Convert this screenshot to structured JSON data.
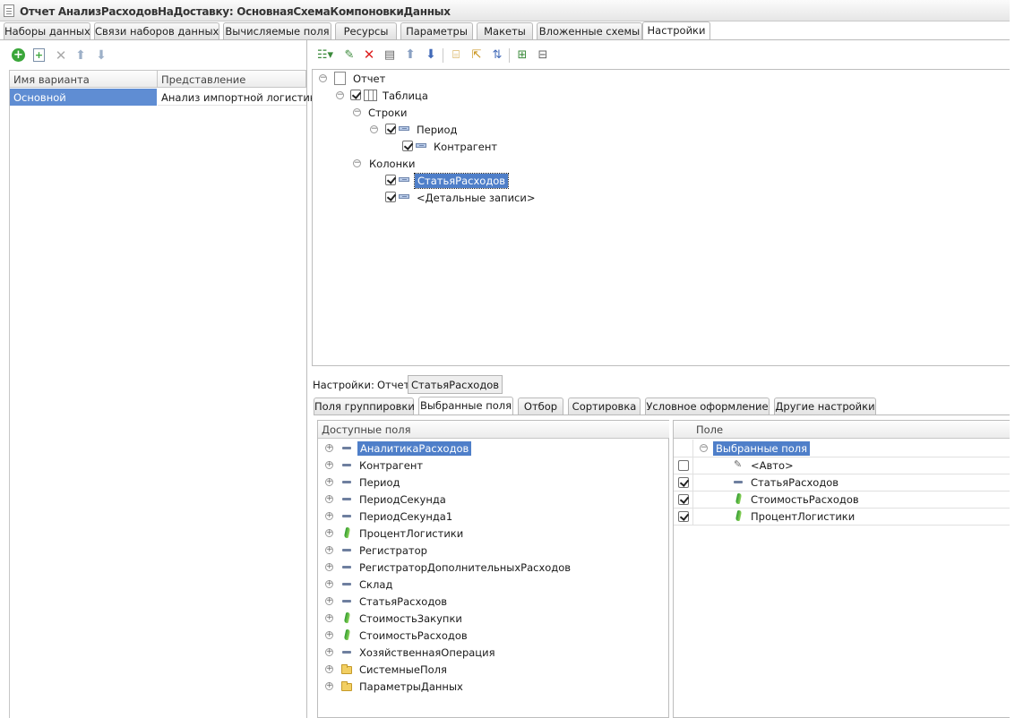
{
  "window": {
    "title": "Отчет АнализРасходовНаДоставку: ОсновнаяСхемаКомпоновкиДанных"
  },
  "top_tabs": [
    {
      "label": "Наборы данных",
      "active": false
    },
    {
      "label": "Связи наборов данных",
      "active": false
    },
    {
      "label": "Вычисляемые поля",
      "active": false
    },
    {
      "label": "Ресурсы",
      "active": false
    },
    {
      "label": "Параметры",
      "active": false
    },
    {
      "label": "Макеты",
      "active": false
    },
    {
      "label": "Вложенные схемы",
      "active": false
    },
    {
      "label": "Настройки",
      "active": true
    }
  ],
  "variants": {
    "toolbar_icons": [
      "add-icon",
      "copy-add-icon",
      "delete-icon",
      "move-up-icon",
      "move-down-icon"
    ],
    "columns": [
      "Имя варианта",
      "Представление"
    ],
    "rows": [
      {
        "name": "Основной",
        "presentation": "Анализ импортной логистики",
        "selected": true
      }
    ]
  },
  "structure": {
    "toolbar_icons": [
      "add-dropdown-icon",
      "edit-icon",
      "delete-icon",
      "properties-icon",
      "move-up-icon",
      "move-down-icon",
      "group-icon",
      "ungroup-icon",
      "swap-icon",
      "expand-icon",
      "collapse-icon"
    ],
    "nodes": [
      {
        "label": "Отчет",
        "kind": "report",
        "toggle": "minus",
        "checkbox": null
      },
      {
        "label": "Таблица",
        "kind": "table",
        "toggle": "minus",
        "checkbox": true
      },
      {
        "label": "Строки",
        "kind": "section",
        "toggle": "minus",
        "checkbox": null
      },
      {
        "label": "Период",
        "kind": "grouping",
        "toggle": "minus",
        "checkbox": true
      },
      {
        "label": "Контрагент",
        "kind": "grouping",
        "toggle": null,
        "checkbox": true
      },
      {
        "label": "Колонки",
        "kind": "section",
        "toggle": "minus",
        "checkbox": null
      },
      {
        "label": "СтатьяРасходов",
        "kind": "grouping",
        "toggle": null,
        "checkbox": true,
        "selected": true
      },
      {
        "label": "<Детальные записи>",
        "kind": "grouping",
        "toggle": null,
        "checkbox": true
      }
    ]
  },
  "settings_bar": {
    "label": "Настройки:",
    "report_button": "Отчет",
    "current_button": "СтатьяРасходов"
  },
  "sub_tabs": [
    {
      "label": "Поля группировки",
      "active": false
    },
    {
      "label": "Выбранные поля",
      "active": true
    },
    {
      "label": "Отбор",
      "active": false
    },
    {
      "label": "Сортировка",
      "active": false
    },
    {
      "label": "Условное оформление",
      "active": false
    },
    {
      "label": "Другие настройки",
      "active": false
    }
  ],
  "available_fields": {
    "header": "Доступные поля",
    "items": [
      {
        "label": "АналитикаРасходов",
        "icon": "dimension-icon",
        "selected": true
      },
      {
        "label": "Контрагент",
        "icon": "dimension-icon"
      },
      {
        "label": "Период",
        "icon": "dimension-icon"
      },
      {
        "label": "ПериодСекунда",
        "icon": "dimension-icon"
      },
      {
        "label": "ПериодСекунда1",
        "icon": "dimension-icon"
      },
      {
        "label": "ПроцентЛогистики",
        "icon": "resource-icon"
      },
      {
        "label": "Регистратор",
        "icon": "dimension-icon"
      },
      {
        "label": "РегистраторДополнительныхРасходов",
        "icon": "dimension-icon"
      },
      {
        "label": "Склад",
        "icon": "dimension-icon"
      },
      {
        "label": "СтатьяРасходов",
        "icon": "dimension-icon"
      },
      {
        "label": "СтоимостьЗакупки",
        "icon": "resource-icon"
      },
      {
        "label": "СтоимостьРасходов",
        "icon": "resource-icon"
      },
      {
        "label": "ХозяйственнаяОперация",
        "icon": "dimension-icon"
      },
      {
        "label": "СистемныеПоля",
        "icon": "folder-icon"
      },
      {
        "label": "ПараметрыДанных",
        "icon": "folder-icon"
      }
    ]
  },
  "selected_fields": {
    "header": "Поле",
    "group_label": "Выбранные поля",
    "items": [
      {
        "label": "<Авто>",
        "icon": "auto-icon",
        "checked": false
      },
      {
        "label": "СтатьяРасходов",
        "icon": "dimension-icon",
        "checked": true
      },
      {
        "label": "СтоимостьРасходов",
        "icon": "resource-icon",
        "checked": true
      },
      {
        "label": "ПроцентЛогистики",
        "icon": "resource-icon",
        "checked": true
      }
    ]
  }
}
